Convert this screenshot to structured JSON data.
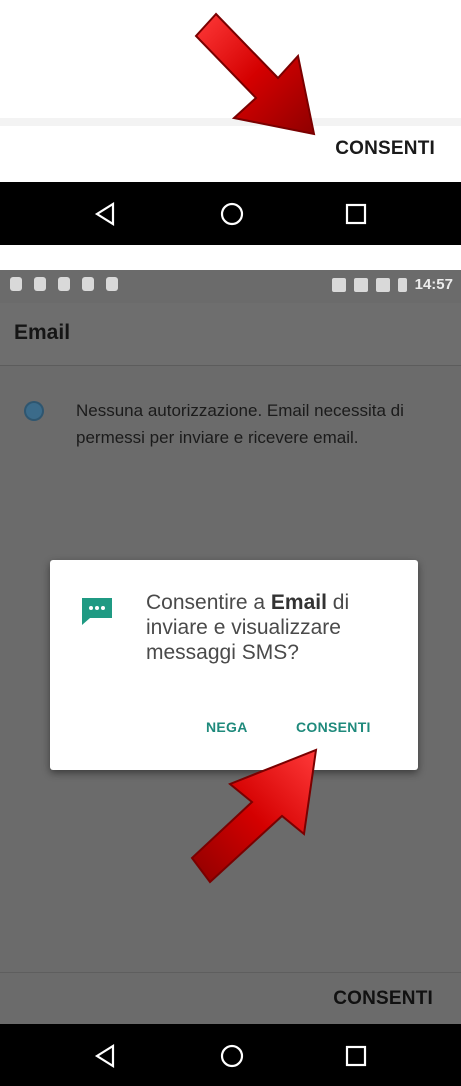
{
  "top_panel": {
    "consenti_label": "CONSENTI"
  },
  "status_bar": {
    "time": "14:57"
  },
  "app": {
    "title": "Email"
  },
  "permission_info": {
    "text": "Nessuna autorizzazione. Email necessita di permessi per inviare e ricevere email."
  },
  "dialog": {
    "message_prefix": "Consentire a ",
    "message_app": "Email",
    "message_suffix": " di inviare e visualizzare messaggi SMS?",
    "deny_label": "NEGA",
    "allow_label": "CONSENTI"
  },
  "bottom_bar": {
    "consenti_label": "CONSENTI"
  },
  "icons": [
    "back-triangle-icon",
    "home-circle-icon",
    "recents-square-icon",
    "sms-message-icon",
    "red-arrow-icon"
  ],
  "colors": {
    "accent": "#1f8a7c",
    "arrow": "#d40000",
    "overlay": "#6b6b6b"
  }
}
